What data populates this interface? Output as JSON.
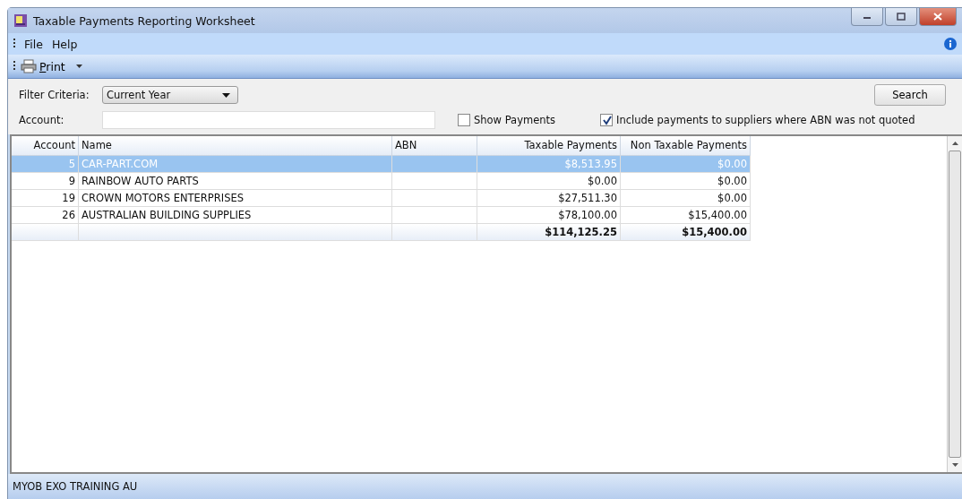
{
  "window": {
    "title": "Taxable Payments Reporting Worksheet"
  },
  "menu": [
    "File",
    "Help"
  ],
  "toolbar": {
    "print": "Print"
  },
  "filter": {
    "label": "Filter Criteria:",
    "value": "Current Year",
    "search": "Search"
  },
  "account": {
    "label": "Account:"
  },
  "options": [
    {
      "label": "Show Payments",
      "checked": false
    },
    {
      "label": "Include payments to suppliers where ABN was not quoted",
      "checked": true
    }
  ],
  "table": {
    "columns": [
      "Account",
      "Name",
      "ABN",
      "Taxable Payments",
      "Non Taxable Payments"
    ],
    "rows": [
      {
        "account": "5",
        "name": "CAR-PART.COM",
        "taxable": "$8,513.95",
        "non_taxable": "$0.00",
        "selected": true
      },
      {
        "account": "9",
        "name": "RAINBOW AUTO PARTS",
        "taxable": "$0.00",
        "non_taxable": "$0.00",
        "selected": false
      },
      {
        "account": "19",
        "name": "CROWN MOTORS ENTERPRISES",
        "taxable": "$27,511.30",
        "non_taxable": "$0.00",
        "selected": false
      },
      {
        "account": "26",
        "name": "AUSTRALIAN BUILDING SUPPLIES",
        "taxable": "$78,100.00",
        "non_taxable": "$15,400.00",
        "selected": false
      }
    ],
    "totals": {
      "taxable": "$114,125.25",
      "non_taxable": "$15,400.00"
    }
  },
  "status_bar": "MYOB EXO TRAINING AU"
}
